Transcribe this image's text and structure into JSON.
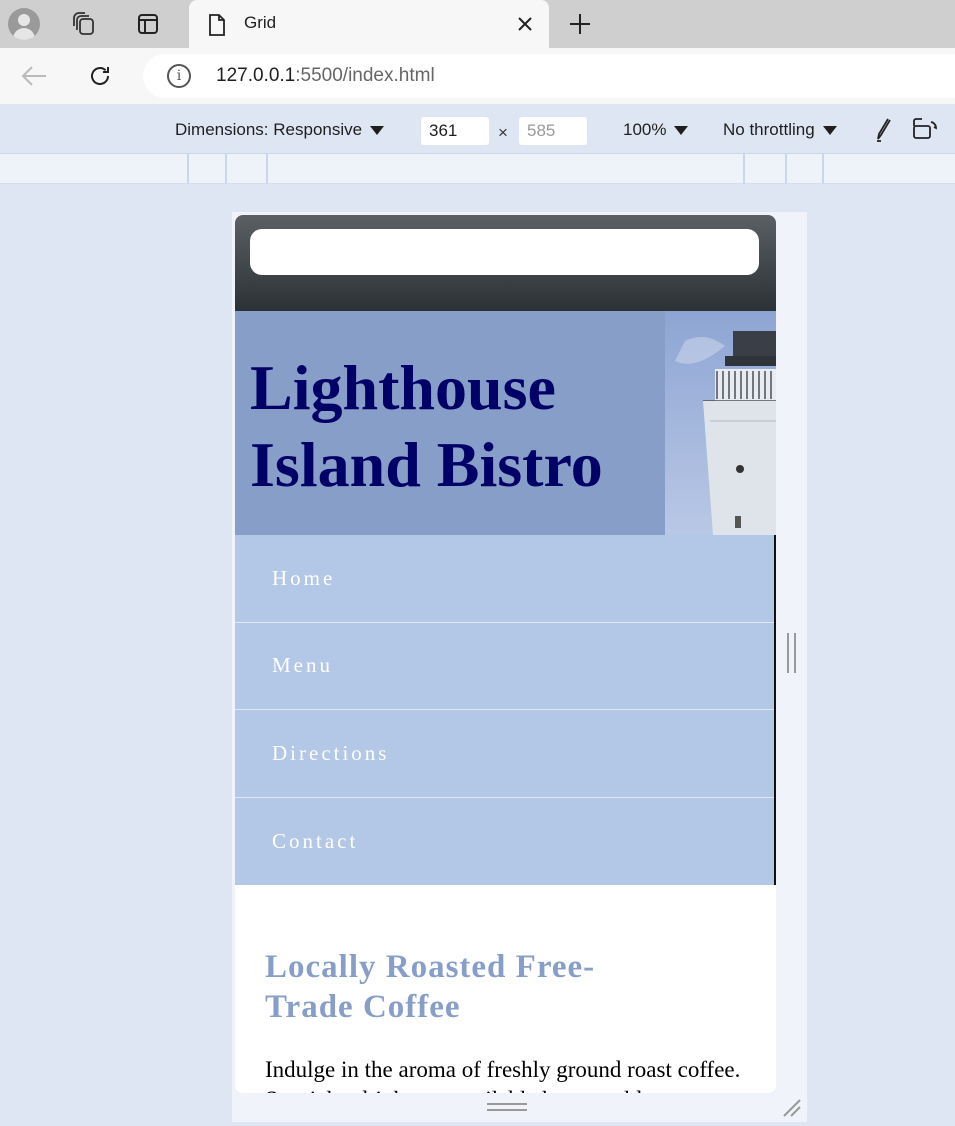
{
  "browser": {
    "tab_title": "Grid",
    "url_host": "127.0.0.1",
    "url_rest": ":5500/index.html"
  },
  "devtools": {
    "dimensions_label": "Dimensions: Responsive",
    "width": "361",
    "height_placeholder": "585",
    "times": "×",
    "zoom": "100%",
    "throttling": "No throttling"
  },
  "site": {
    "title": "Lighthouse Island Bistro",
    "nav": [
      {
        "label": "Home"
      },
      {
        "label": "Menu"
      },
      {
        "label": "Directions"
      },
      {
        "label": "Contact"
      }
    ],
    "heading": "Locally Roasted Free-Trade Coffee",
    "paragraph": "Indulge in the aroma of freshly ground roast coffee. Specialty drinks are available hot or cold."
  },
  "colors": {
    "banner": "#879ec9",
    "title": "#000066",
    "nav_bg": "#b3c7e6",
    "heading": "#879ec9"
  },
  "icons": [
    "profile-icon",
    "workspaces-icon",
    "vertical-tabs-icon",
    "page-icon",
    "close-icon",
    "plus-icon",
    "back-arrow-icon",
    "reload-icon",
    "info-icon",
    "caret-down-icon",
    "pen-icon",
    "rotate-icon"
  ]
}
